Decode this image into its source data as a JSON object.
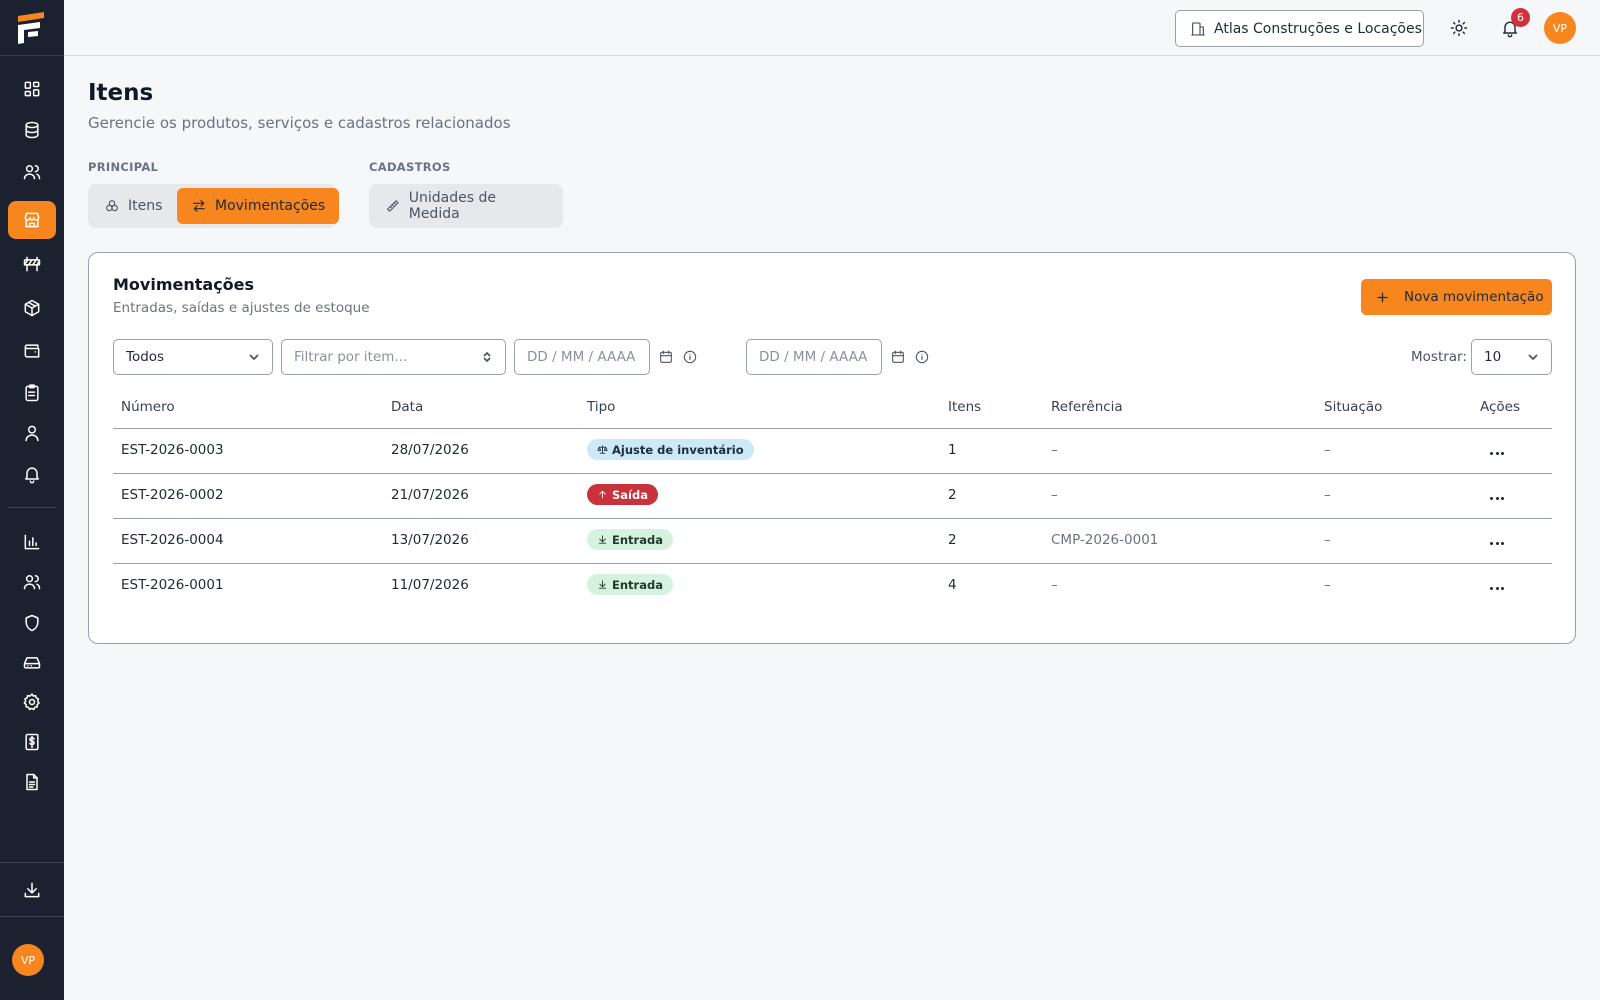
{
  "colors": {
    "accent": "#f7861f",
    "sidebar": "#1c2130",
    "danger": "#c8323a",
    "info_badge": "#cde8f6",
    "success_badge": "#d5f2df"
  },
  "sidebar": {
    "logo": "company-logo",
    "items": [
      {
        "name": "dashboard-icon"
      },
      {
        "name": "database-icon"
      },
      {
        "name": "users-icon"
      },
      {
        "name": "store-icon",
        "active": true
      },
      {
        "name": "barrier-icon"
      },
      {
        "name": "package-icon"
      },
      {
        "name": "wallet-icon"
      },
      {
        "name": "clipboard-icon"
      },
      {
        "name": "user-icon"
      },
      {
        "name": "bell-icon"
      },
      {
        "name": "chart-icon"
      },
      {
        "name": "team-icon"
      },
      {
        "name": "shield-icon"
      },
      {
        "name": "drive-icon"
      },
      {
        "name": "gear-icon"
      },
      {
        "name": "dollar-receipt-icon"
      },
      {
        "name": "document-icon"
      },
      {
        "name": "download-icon"
      }
    ],
    "avatar_initials": "VP"
  },
  "topbar": {
    "company": "Atlas Construções e Locações",
    "notifications_count": "6",
    "avatar_initials": "VP"
  },
  "page": {
    "title": "Itens",
    "subtitle": "Gerencie os produtos, serviços e cadastros relacionados"
  },
  "tabs": {
    "principal_label": "PRINCIPAL",
    "cadastros_label": "CADASTROS",
    "itens": "Itens",
    "movimentacoes": "Movimentações",
    "unidades": "Unidades de Medida"
  },
  "card": {
    "title": "Movimentações",
    "subtitle": "Entradas, saídas e ajustes de estoque",
    "new_button": "Nova movimentação"
  },
  "filters": {
    "type_value": "Todos",
    "item_placeholder": "Filtrar por item...",
    "date_from_placeholder": "DD / MM / AAAA",
    "date_to_placeholder": "DD / MM / AAAA",
    "show_label": "Mostrar:",
    "show_value": "10"
  },
  "table": {
    "headers": [
      "Número",
      "Data",
      "Tipo",
      "Itens",
      "Referência",
      "Situação",
      "Ações"
    ],
    "rows": [
      {
        "numero": "EST-2026-0003",
        "data": "28/07/2026",
        "tipo": "Ajuste de inventário",
        "tipo_kind": "ajuste",
        "itens": "1",
        "referencia": "–",
        "situacao": "–"
      },
      {
        "numero": "EST-2026-0002",
        "data": "21/07/2026",
        "tipo": "Saída",
        "tipo_kind": "saida",
        "itens": "2",
        "referencia": "–",
        "situacao": "–"
      },
      {
        "numero": "EST-2026-0004",
        "data": "13/07/2026",
        "tipo": "Entrada",
        "tipo_kind": "entrada",
        "itens": "2",
        "referencia": "CMP-2026-0001",
        "situacao": "–"
      },
      {
        "numero": "EST-2026-0001",
        "data": "11/07/2026",
        "tipo": "Entrada",
        "tipo_kind": "entrada",
        "itens": "4",
        "referencia": "–",
        "situacao": "–"
      }
    ]
  }
}
